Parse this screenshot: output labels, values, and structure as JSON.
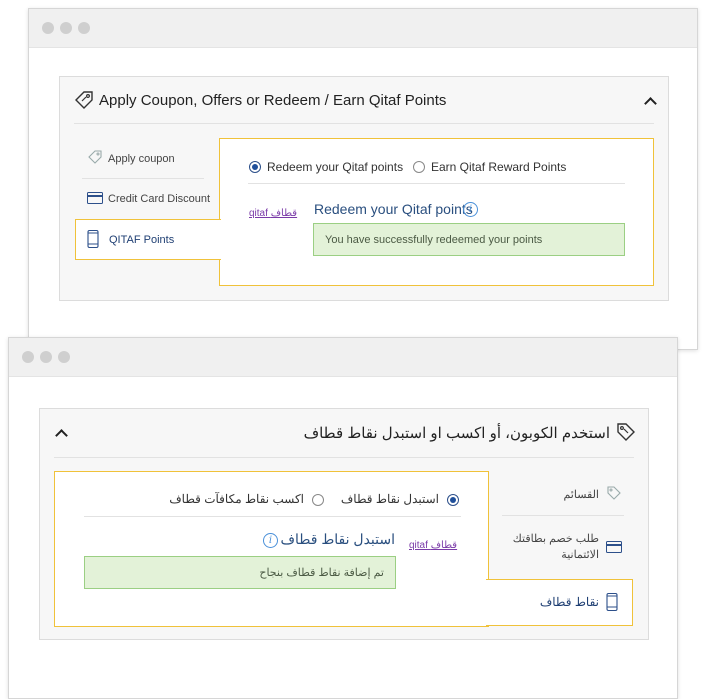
{
  "en": {
    "panel_title": "Apply Coupon, Offers or Redeem / Earn Qitaf Points",
    "sidebar": [
      {
        "label": "Apply coupon",
        "icon": "tag-icon"
      },
      {
        "label": "Credit Card Discount",
        "icon": "credit-card-icon"
      },
      {
        "label": "QITAF Points",
        "icon": "mobile-phone-icon",
        "active": true
      }
    ],
    "radio_redeem": "Redeem your Qitaf points",
    "radio_earn": "Earn Qitaf Reward Points",
    "redeem_heading": "Redeem your Qitaf points",
    "qitaf_logo": "qitaf قطاف",
    "success_message": "You have successfully redeemed your points"
  },
  "ar": {
    "panel_title": "استخدم الكوبون، أو اكسب او استبدل نقاط قطاف",
    "sidebar": [
      {
        "label": "القسائم",
        "icon": "tag-icon"
      },
      {
        "label_line1": "طلب خصم بطاقتك",
        "label_line2": "الائتمانية",
        "icon": "credit-card-icon"
      },
      {
        "label": "نقاط قطاف",
        "icon": "mobile-phone-icon",
        "active": true
      }
    ],
    "radio_redeem": "استبدل نقاط قطاف",
    "radio_earn": "اكسب نقاط مكافآت قطاف",
    "redeem_heading": "استبدل نقاط قطاف",
    "qitaf_logo": "qitaf قطاف",
    "success_message": "تم إضافة نقاط قطاف بنجاح"
  },
  "colors": {
    "accent_yellow": "#f0c23a",
    "link_blue": "#2a4f7f",
    "radio_blue": "#1f4f9a",
    "success_bg": "#e3f2d8"
  }
}
